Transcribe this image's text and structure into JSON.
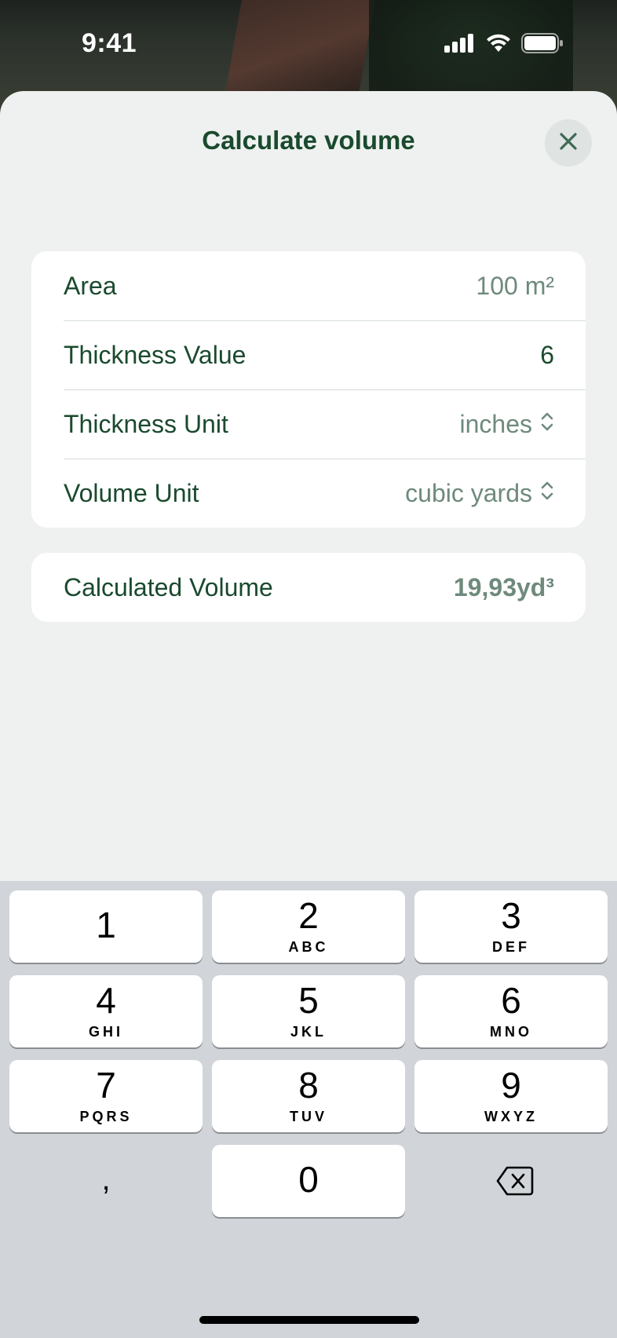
{
  "status_bar": {
    "time": "9:41"
  },
  "sheet": {
    "title": "Calculate volume"
  },
  "form": {
    "rows": [
      {
        "label": "Area",
        "value": "100 m²"
      },
      {
        "label": "Thickness Value",
        "value": "6"
      },
      {
        "label": "Thickness Unit",
        "value": "inches"
      },
      {
        "label": "Volume Unit",
        "value": "cubic yards"
      }
    ]
  },
  "result": {
    "label": "Calculated Volume",
    "value": "19,93yd³"
  },
  "keyboard": {
    "keys": [
      {
        "num": "1",
        "letters": ""
      },
      {
        "num": "2",
        "letters": "ABC"
      },
      {
        "num": "3",
        "letters": "DEF"
      },
      {
        "num": "4",
        "letters": "GHI"
      },
      {
        "num": "5",
        "letters": "JKL"
      },
      {
        "num": "6",
        "letters": "MNO"
      },
      {
        "num": "7",
        "letters": "PQRS"
      },
      {
        "num": "8",
        "letters": "TUV"
      },
      {
        "num": "9",
        "letters": "WXYZ"
      },
      {
        "num": "0",
        "letters": ""
      }
    ],
    "decimal": ","
  },
  "colors": {
    "accent": "#1a4a2e",
    "muted_value": "#6e8a7c",
    "sheet_bg": "#eff1f0",
    "keyboard_bg": "#d1d4d9"
  }
}
